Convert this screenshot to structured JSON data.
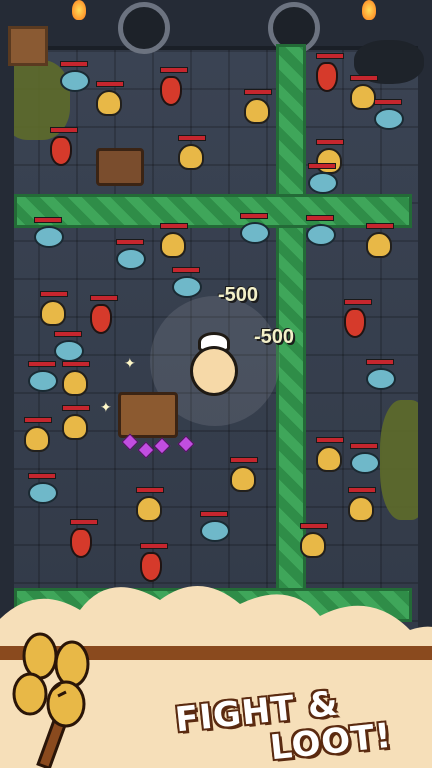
{
  "damage_popups": [
    "-500",
    "-500"
  ],
  "banner": {
    "line1": "FIGHT &",
    "line2": "LOOT!"
  },
  "icons": {
    "emblem": "wheat-icon",
    "hero": "hamster-chef-icon"
  },
  "colors": {
    "vine": "#3fa65a",
    "floor": "#353d4b",
    "banner_cream": "#f6dfb9",
    "banner_brown": "#8a4a1e",
    "hp_red": "#c6262e"
  }
}
